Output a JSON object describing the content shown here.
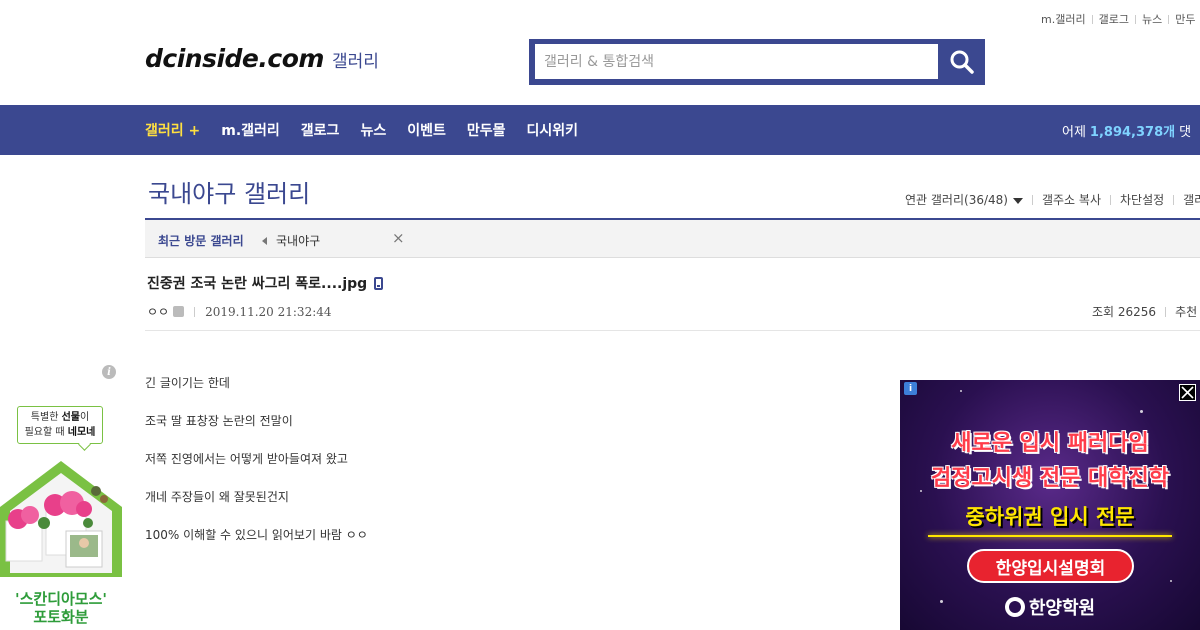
{
  "top_links": [
    "m.갤러리",
    "갤로그",
    "뉴스",
    "만두"
  ],
  "logo": {
    "main": "dcinside.com",
    "sub": "갤러리"
  },
  "search": {
    "placeholder": "갤러리 & 통합검색"
  },
  "nav": {
    "items": [
      "갤러리 +",
      "m.갤러리",
      "갤로그",
      "뉴스",
      "이벤트",
      "만두몰",
      "디시위키"
    ],
    "stats_label": "어제",
    "stats_value": "1,894,378개",
    "stats_suffix": "댓"
  },
  "gallery": {
    "title": "국내야구 갤러리",
    "related": "연관 갤러리(36/48)",
    "copy_addr": "갤주소 복사",
    "block_settings": "차단설정",
    "more": "갤러"
  },
  "recent": {
    "label": "최근 방문 갤러리",
    "tag": "국내야구",
    "close": "×"
  },
  "post": {
    "title": "진중권 조국 논란 싸그리 폭로....jpg",
    "author": "ㅇㅇ",
    "date": "2019.11.20 21:32:44",
    "views": "조회 26256",
    "recommend": "추천",
    "body": [
      "긴 글이기는 한데",
      "조국 딸 표창장 논란의 전말이",
      "저쪽 진영에서는 어떻게 받아들여져 왔고",
      "개네 주장들이 왜 잘못된건지",
      "100% 이해할 수 있으니 읽어보기 바람 ㅇㅇ"
    ]
  },
  "left_ad": {
    "info": "i",
    "bubble_line1_a": "특별한 ",
    "bubble_line1_b": "선물",
    "bubble_line1_c": "이",
    "bubble_line2_a": "필요할 때 ",
    "bubble_line2_b": "네모네",
    "brand_line1": "'스칸디아모스'",
    "brand_line2": "포토화분"
  },
  "right_ad": {
    "info": "i",
    "line1": "새로운 입시 패러다임",
    "line2": "검정고시생 전문 대학진학",
    "line3": "중하위권 입시 전문",
    "button": "한양입시설명회",
    "logo": "한양학원"
  },
  "colors": {
    "brand": "#3b4890",
    "nav_active": "#ffe040",
    "stats": "#7fd3ff"
  }
}
